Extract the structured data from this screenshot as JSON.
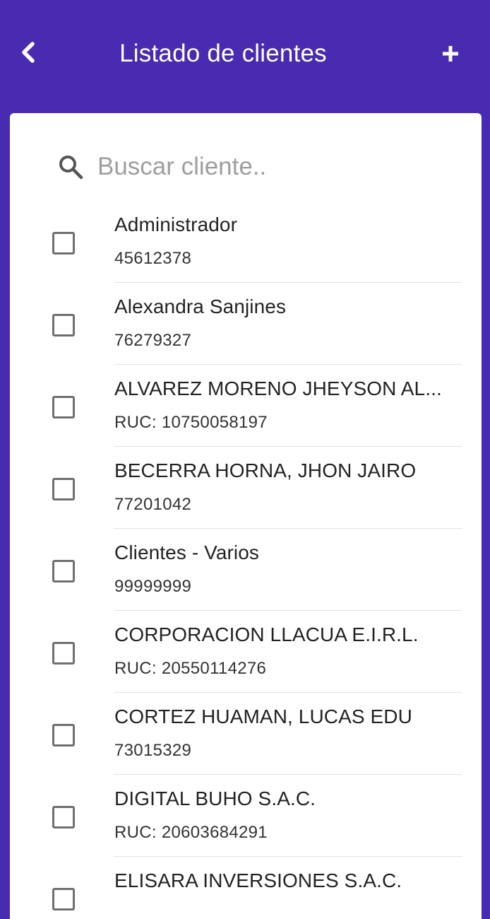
{
  "header": {
    "title": "Listado de clientes",
    "back_icon": "chevron-left-icon",
    "add_icon": "plus-icon",
    "background": "#482bb0"
  },
  "search": {
    "placeholder": "Buscar cliente..",
    "value": "",
    "icon": "search-icon"
  },
  "clients": [
    {
      "name": "Administrador",
      "doc": "45612378",
      "checked": false
    },
    {
      "name": "Alexandra Sanjines",
      "doc": "76279327",
      "checked": false
    },
    {
      "name": "ALVAREZ MORENO JHEYSON AL...",
      "doc": "RUC: 10750058197",
      "checked": false
    },
    {
      "name": "BECERRA HORNA, JHON JAIRO",
      "doc": "77201042",
      "checked": false
    },
    {
      "name": "Clientes - Varios",
      "doc": "99999999",
      "checked": false
    },
    {
      "name": "CORPORACION LLACUA E.I.R.L.",
      "doc": "RUC: 20550114276",
      "checked": false
    },
    {
      "name": "CORTEZ HUAMAN, LUCAS EDU",
      "doc": "73015329",
      "checked": false
    },
    {
      "name": "DIGITAL BUHO S.A.C.",
      "doc": "RUC: 20603684291",
      "checked": false
    },
    {
      "name": "ELISARA INVERSIONES S.A.C.",
      "doc": "",
      "checked": false
    }
  ]
}
